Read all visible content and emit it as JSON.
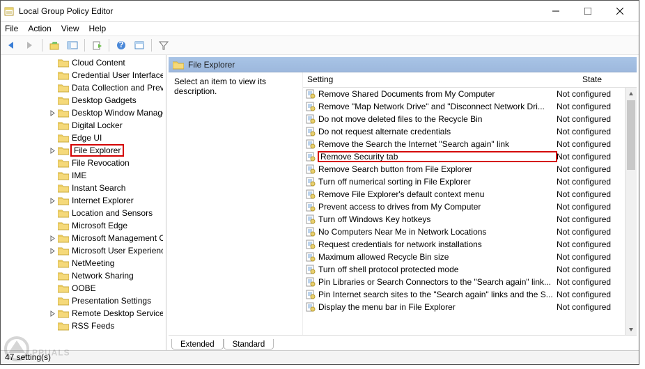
{
  "window": {
    "title": "Local Group Policy Editor"
  },
  "menu": {
    "file": "File",
    "action": "Action",
    "view": "View",
    "help": "Help"
  },
  "tree": {
    "indent_base": 82,
    "items": [
      {
        "label": "Cloud Content",
        "expander": "none",
        "highlighted": false
      },
      {
        "label": "Credential User Interface",
        "expander": "none",
        "highlighted": false
      },
      {
        "label": "Data Collection and Preview",
        "expander": "none",
        "highlighted": false
      },
      {
        "label": "Desktop Gadgets",
        "expander": "none",
        "highlighted": false
      },
      {
        "label": "Desktop Window Manager",
        "expander": "closed",
        "highlighted": false
      },
      {
        "label": "Digital Locker",
        "expander": "none",
        "highlighted": false
      },
      {
        "label": "Edge UI",
        "expander": "none",
        "highlighted": false
      },
      {
        "label": "File Explorer",
        "expander": "closed",
        "highlighted": true
      },
      {
        "label": "File Revocation",
        "expander": "none",
        "highlighted": false
      },
      {
        "label": "IME",
        "expander": "none",
        "highlighted": false
      },
      {
        "label": "Instant Search",
        "expander": "none",
        "highlighted": false
      },
      {
        "label": "Internet Explorer",
        "expander": "closed",
        "highlighted": false
      },
      {
        "label": "Location and Sensors",
        "expander": "none",
        "highlighted": false
      },
      {
        "label": "Microsoft Edge",
        "expander": "none",
        "highlighted": false
      },
      {
        "label": "Microsoft Management Console",
        "expander": "closed",
        "highlighted": false
      },
      {
        "label": "Microsoft User Experience",
        "expander": "closed",
        "highlighted": false
      },
      {
        "label": "NetMeeting",
        "expander": "none",
        "highlighted": false
      },
      {
        "label": "Network Sharing",
        "expander": "none",
        "highlighted": false
      },
      {
        "label": "OOBE",
        "expander": "none",
        "highlighted": false
      },
      {
        "label": "Presentation Settings",
        "expander": "none",
        "highlighted": false
      },
      {
        "label": "Remote Desktop Services",
        "expander": "closed",
        "highlighted": false
      },
      {
        "label": "RSS Feeds",
        "expander": "none",
        "highlighted": false
      }
    ]
  },
  "right": {
    "header": "File Explorer",
    "description": "Select an item to view its description.",
    "columns": {
      "setting": "Setting",
      "state": "State"
    },
    "rows": [
      {
        "setting": "Remove Shared Documents from My Computer",
        "state": "Not configured",
        "highlighted": false
      },
      {
        "setting": "Remove \"Map Network Drive\" and \"Disconnect Network Dri...",
        "state": "Not configured",
        "highlighted": false
      },
      {
        "setting": "Do not move deleted files to the Recycle Bin",
        "state": "Not configured",
        "highlighted": false
      },
      {
        "setting": "Do not request alternate credentials",
        "state": "Not configured",
        "highlighted": false
      },
      {
        "setting": "Remove the Search the Internet \"Search again\" link",
        "state": "Not configured",
        "highlighted": false
      },
      {
        "setting": "Remove Security tab",
        "state": "Not configured",
        "highlighted": true
      },
      {
        "setting": "Remove Search button from File Explorer",
        "state": "Not configured",
        "highlighted": false
      },
      {
        "setting": "Turn off numerical sorting in File Explorer",
        "state": "Not configured",
        "highlighted": false
      },
      {
        "setting": "Remove File Explorer's default context menu",
        "state": "Not configured",
        "highlighted": false
      },
      {
        "setting": "Prevent access to drives from My Computer",
        "state": "Not configured",
        "highlighted": false
      },
      {
        "setting": "Turn off Windows Key hotkeys",
        "state": "Not configured",
        "highlighted": false
      },
      {
        "setting": "No Computers Near Me in Network Locations",
        "state": "Not configured",
        "highlighted": false
      },
      {
        "setting": "Request credentials for network installations",
        "state": "Not configured",
        "highlighted": false
      },
      {
        "setting": "Maximum allowed Recycle Bin size",
        "state": "Not configured",
        "highlighted": false
      },
      {
        "setting": "Turn off shell protocol protected mode",
        "state": "Not configured",
        "highlighted": false
      },
      {
        "setting": "Pin Libraries or Search Connectors to the \"Search again\" link...",
        "state": "Not configured",
        "highlighted": false
      },
      {
        "setting": "Pin Internet search sites to the \"Search again\" links and the S...",
        "state": "Not configured",
        "highlighted": false
      },
      {
        "setting": "Display the menu bar in File Explorer",
        "state": "Not configured",
        "highlighted": false
      }
    ]
  },
  "tabs": {
    "extended": "Extended",
    "standard": "Standard"
  },
  "status": "47 setting(s)",
  "watermark": "PPUALS"
}
